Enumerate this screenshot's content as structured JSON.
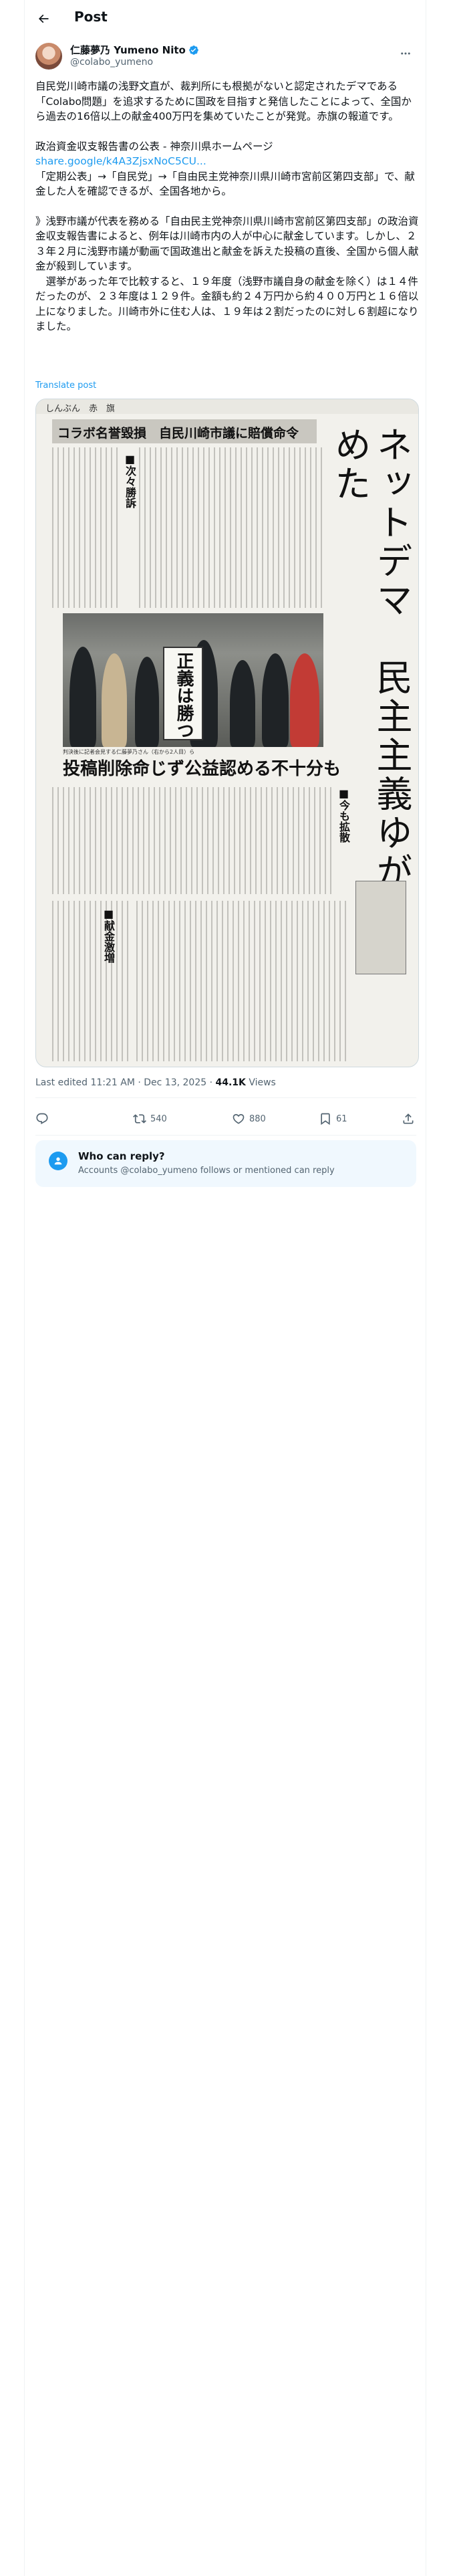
{
  "header": {
    "title": "Post"
  },
  "author": {
    "name": "仁藤夢乃 Yumeno Nito",
    "handle": "@colabo_yumeno"
  },
  "post": {
    "paragraph1": "自民党川崎市議の浅野文直が、裁判所にも根拠がないと認定されたデマである「Colabo問題」を追求するために国政を目指すと発信したことによって、全国から過去の16倍以上の献金400万円を集めていたことが発覚。赤旗の報道です。",
    "paragraph2_line1": "政治資金収支報告書の公表 - 神奈川県ホームページ",
    "paragraph2_link": "share.google/k4A3ZjsxNoC5CU...",
    "paragraph2_line3": "「定期公表」→「自民党」→「自由民主党神奈川県川崎市宮前区第四支部」で、献金した人を確認できるが、全国各地から。",
    "paragraph3": "》浅野市議が代表を務める「自由民主党神奈川県川崎市宮前区第四支部」の政治資金収支報告書によると、例年は川崎市内の人が中心に献金しています。しかし、２３年２月に浅野市議が動画で国政進出と献金を訴えた投稿の直後、全国から個人献金が殺到しています。",
    "paragraph4": "選挙があった年で比較すると、１９年度（浅野市議自身の献金を除く）は１４件だったのが、２３年度は１２９件。金額も約２４万円から約４００万円と１６倍以上になりました。川崎市外に住む人は、１９年は２割だったのに対し６割超になりました。",
    "translate_label": "Translate post"
  },
  "newspaper": {
    "masthead": "しんぶん　赤　旗",
    "top_headline": "コラボ名誉毀損　自民川崎市議に賠償命令",
    "vertical_headline": "ネットデマ　民主主義ゆがめた",
    "sub1": "■次々勝訴",
    "sub2": "■今も拡散",
    "sub3": "■献金激増",
    "mid_headline": "投稿削除命じず公益認める不十分も",
    "sign_text": "正義は勝つ",
    "photo_caption": "判決後に記者会見する仁藤夢乃さん（右から2人目）ら"
  },
  "meta": {
    "edited": "Last edited 11:21 AM · Dec 13, 2025 · ",
    "views_count": "44.1K",
    "views_label": " Views"
  },
  "actions": {
    "reply_icon": "reply-icon",
    "retweet_count": "540",
    "like_count": "880",
    "bookmark_count": "61"
  },
  "reply_restriction": {
    "title": "Who can reply?",
    "subtitle": "Accounts @colabo_yumeno follows or mentioned can reply"
  },
  "colors": {
    "accent": "#1d9bf0",
    "muted": "#536471",
    "text": "#0f1419"
  }
}
